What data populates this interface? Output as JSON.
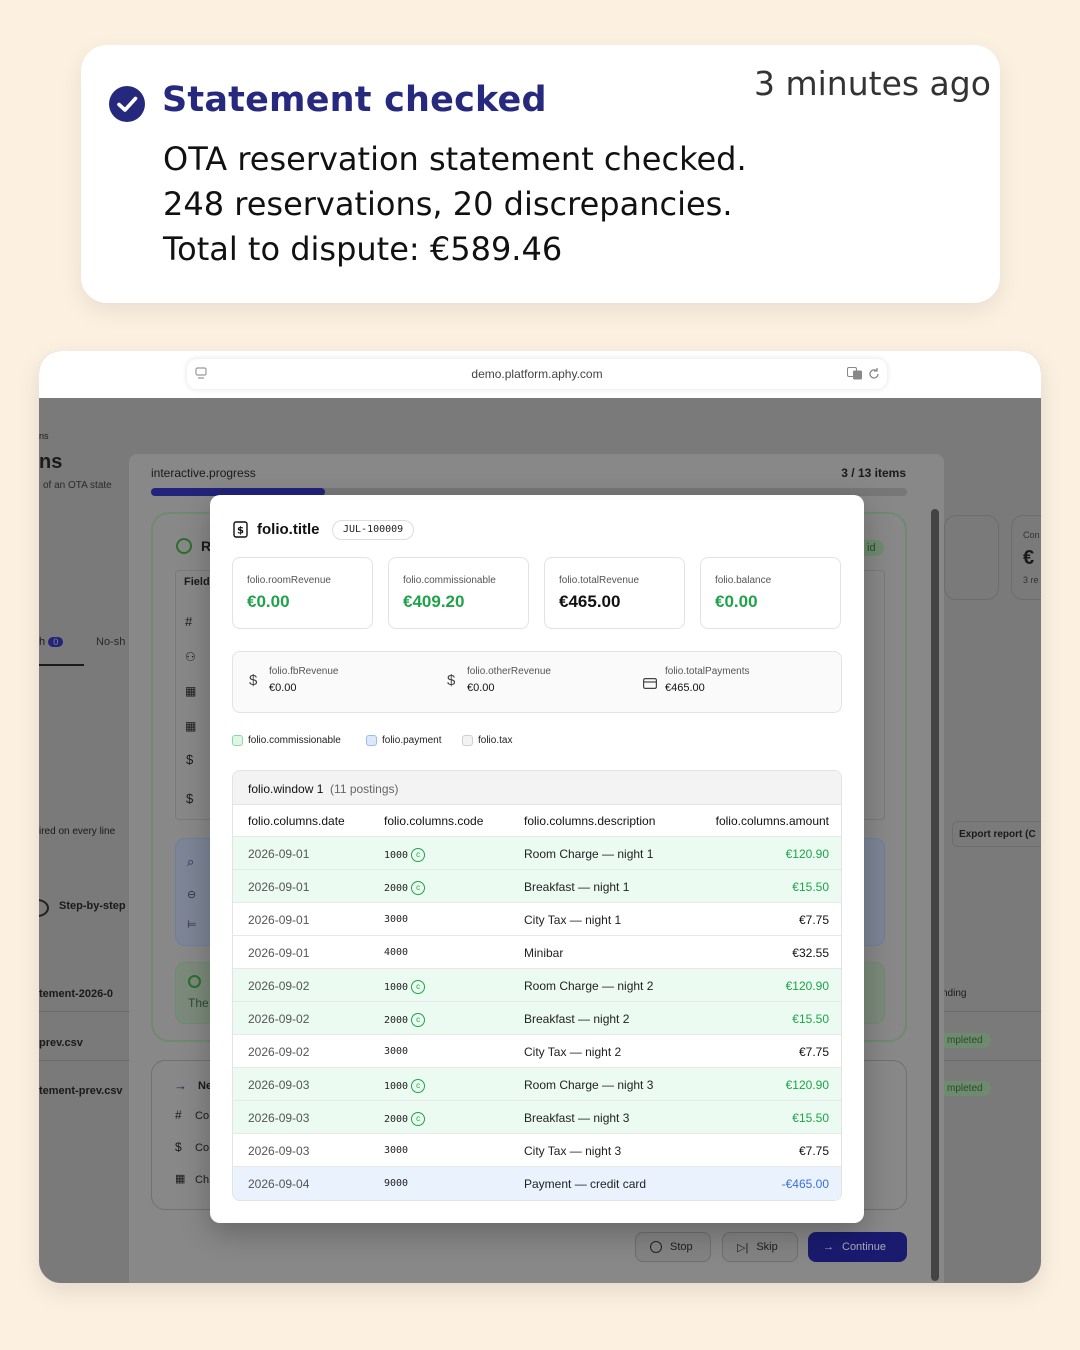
{
  "notification": {
    "title": "Statement checked",
    "time": "3 minutes ago",
    "lines": [
      "OTA reservation statement checked.",
      "248 reservations, 20 discrepancies.",
      "Total to dispute: €589.46"
    ]
  },
  "browser": {
    "url": "demo.platform.aphy.com"
  },
  "background": {
    "crumb": "ns",
    "page_title": "ns",
    "page_sub": "of an OTA state",
    "progress_label": "interactive.progress",
    "progress_count": "3 / 13 items",
    "progress": 0.23,
    "tab_count": "0",
    "tab_noshow": "No-sh",
    "field_label": "Field",
    "line_text": "ired on every line",
    "step_text": "Step-by-step",
    "files": [
      "tement-2026-0",
      "prev.csv",
      "tement-prev.csv"
    ],
    "export": "Export report (C",
    "right_card_label": "Con",
    "right_card_val": "€",
    "right_card_sub": "3 re",
    "status": [
      "nding",
      "mpleted",
      "mpleted"
    ],
    "notice": "The",
    "side_labels": [
      "Ne",
      "Co",
      "Co",
      "Ch"
    ],
    "paid_badge": "id",
    "buttons": {
      "stop": "Stop",
      "skip": "Skip",
      "continue": "Continue"
    }
  },
  "folio": {
    "title": "folio.title",
    "badge": "JUL-100009",
    "stats": [
      {
        "label": "folio.roomRevenue",
        "value": "€0.00",
        "tone": "green"
      },
      {
        "label": "folio.commissionable",
        "value": "€409.20",
        "tone": "green"
      },
      {
        "label": "folio.totalRevenue",
        "value": "€465.00",
        "tone": "dark"
      },
      {
        "label": "folio.balance",
        "value": "€0.00",
        "tone": "green"
      }
    ],
    "subs": [
      {
        "label": "folio.fbRevenue",
        "value": "€0.00",
        "icon": "dollar-icon"
      },
      {
        "label": "folio.otherRevenue",
        "value": "€0.00",
        "icon": "dollar-icon"
      },
      {
        "label": "folio.totalPayments",
        "value": "€465.00",
        "icon": "card-icon"
      }
    ],
    "legend": [
      {
        "label": "folio.commissionable",
        "color": "#dff6e7",
        "border": "#8fd7a6"
      },
      {
        "label": "folio.payment",
        "color": "#dde9fb",
        "border": "#9bbcec"
      },
      {
        "label": "folio.tax",
        "color": "#f3f3f3",
        "border": "#cfcfcf"
      }
    ],
    "window": {
      "label": "folio.window 1",
      "count": "(11 postings)"
    },
    "columns": {
      "date": "folio.columns.date",
      "code": "folio.columns.code",
      "description": "folio.columns.description",
      "amount": "folio.columns.amount"
    },
    "rows": [
      {
        "date": "2026-09-01",
        "code": "1000",
        "c": true,
        "desc": "Room Charge — night 1",
        "amount": "€120.90",
        "type": "com"
      },
      {
        "date": "2026-09-01",
        "code": "2000",
        "c": true,
        "desc": "Breakfast — night 1",
        "amount": "€15.50",
        "type": "com"
      },
      {
        "date": "2026-09-01",
        "code": "3000",
        "c": false,
        "desc": "City Tax — night 1",
        "amount": "€7.75",
        "type": "tax"
      },
      {
        "date": "2026-09-01",
        "code": "4000",
        "c": false,
        "desc": "Minibar",
        "amount": "€32.55",
        "type": "tax"
      },
      {
        "date": "2026-09-02",
        "code": "1000",
        "c": true,
        "desc": "Room Charge — night 2",
        "amount": "€120.90",
        "type": "com"
      },
      {
        "date": "2026-09-02",
        "code": "2000",
        "c": true,
        "desc": "Breakfast — night 2",
        "amount": "€15.50",
        "type": "com"
      },
      {
        "date": "2026-09-02",
        "code": "3000",
        "c": false,
        "desc": "City Tax — night 2",
        "amount": "€7.75",
        "type": "tax"
      },
      {
        "date": "2026-09-03",
        "code": "1000",
        "c": true,
        "desc": "Room Charge — night 3",
        "amount": "€120.90",
        "type": "com"
      },
      {
        "date": "2026-09-03",
        "code": "2000",
        "c": true,
        "desc": "Breakfast — night 3",
        "amount": "€15.50",
        "type": "com"
      },
      {
        "date": "2026-09-03",
        "code": "3000",
        "c": false,
        "desc": "City Tax — night 3",
        "amount": "€7.75",
        "type": "tax"
      },
      {
        "date": "2026-09-04",
        "code": "9000",
        "c": false,
        "desc": "Payment — credit card",
        "amount": "-€465.00",
        "type": "pay"
      }
    ]
  }
}
